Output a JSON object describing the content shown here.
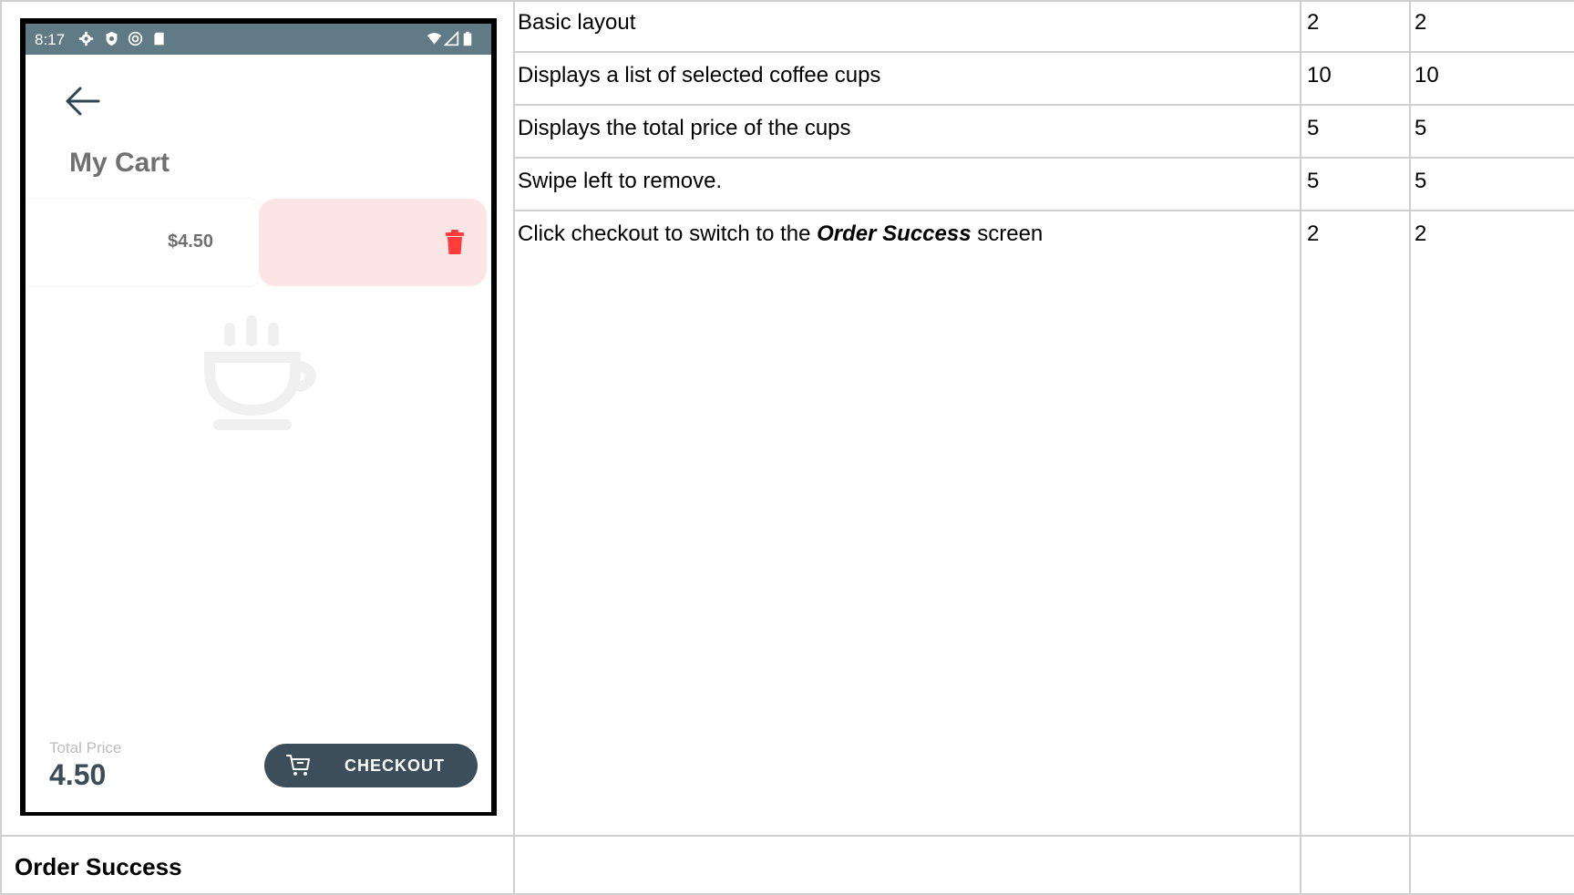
{
  "phone": {
    "status_time": "8:17",
    "title": "My Cart",
    "item_price": "$4.50",
    "total_label": "Total Price",
    "total_value": "4.50",
    "checkout_label": "CHECKOUT",
    "colors": {
      "status_bar": "#617b86",
      "delete_bg": "#fde5e6",
      "delete_icon": "#ff3b3b",
      "checkout_bg": "#3b4e5a"
    },
    "icons": [
      "settings-icon",
      "shield-icon",
      "sync-icon",
      "sd-card-icon",
      "wifi-icon",
      "signal-icon",
      "battery-icon",
      "back-arrow-icon",
      "trash-icon",
      "coffee-cup-icon",
      "cart-icon"
    ]
  },
  "rubric": [
    {
      "criterion": "Basic layout",
      "col1": "2",
      "col2": "2"
    },
    {
      "criterion": "Displays a list of selected coffee cups",
      "col1": "10",
      "col2": "10"
    },
    {
      "criterion": "Displays the total price of the cups",
      "col1": "5",
      "col2": "5"
    },
    {
      "criterion": "Swipe left to remove.",
      "col1": "5",
      "col2": "5"
    },
    {
      "criterion_pre": "Click checkout to switch to the ",
      "criterion_em": "Order Success",
      "criterion_post": " screen",
      "col1": "2",
      "col2": "2"
    }
  ],
  "footer": {
    "heading": "Order Success"
  }
}
